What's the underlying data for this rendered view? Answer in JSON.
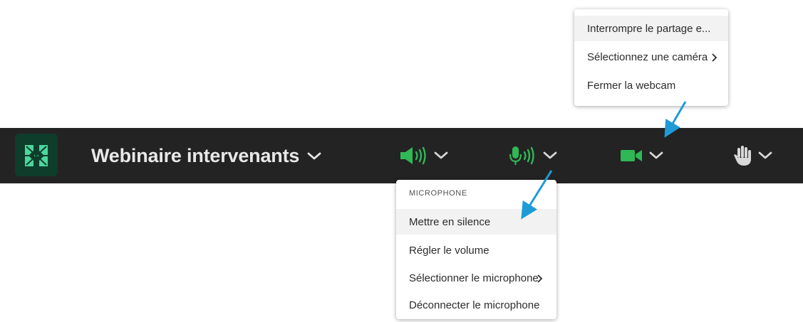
{
  "toolbar": {
    "room_title": "Webinaire intervenants",
    "controls": [
      {
        "name": "speaker",
        "icon": "speaker-icon",
        "color": "#2fb855"
      },
      {
        "name": "microphone",
        "icon": "microphone-icon",
        "color": "#2fb855"
      },
      {
        "name": "camera",
        "icon": "camera-icon",
        "color": "#2fb855"
      },
      {
        "name": "raise-hand",
        "icon": "raise-hand-icon",
        "color": "#d8d8d8"
      }
    ],
    "background_color": "#232323"
  },
  "camera_menu": {
    "items": [
      {
        "label": "Interrompre le partage e..."
      },
      {
        "label": "Sélectionnez une caméra",
        "has_submenu": true
      },
      {
        "label": "Fermer la webcam"
      }
    ]
  },
  "mic_menu": {
    "heading": "MICROPHONE",
    "items": [
      {
        "label": "Mettre en silence"
      },
      {
        "label": "Régler le volume"
      },
      {
        "label": "Sélectionner le microphone",
        "has_submenu": true
      },
      {
        "label": "Déconnecter le microphone"
      }
    ]
  },
  "annotation_color": "#1e9bd7"
}
